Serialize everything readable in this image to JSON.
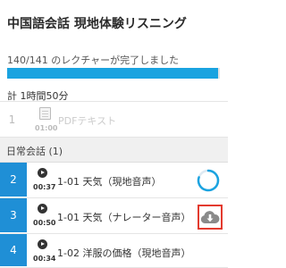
{
  "course": {
    "title": "中国語会話 現地体験リスニング",
    "progress_text": "140/141 のレクチャーが完了しました",
    "progress_fraction": 0.993,
    "total_time": "計 1時間50分"
  },
  "pdf_item": {
    "number": "1",
    "duration": "01:00",
    "label": "PDFテキスト",
    "icon": "document-icon"
  },
  "section": {
    "label": "日常会話 (1)"
  },
  "lessons": [
    {
      "number": "2",
      "duration": "00:37",
      "title": "1-01 天気（現地音声）",
      "status_icon": "progress-ring-icon"
    },
    {
      "number": "3",
      "duration": "00:50",
      "title": "1-01 天気（ナレーター音声）",
      "status_icon": "cloud-download-icon"
    },
    {
      "number": "4",
      "duration": "00:34",
      "title": "1-02 洋服の価格（現地音声）"
    }
  ],
  "colors": {
    "accent": "#1f8fd6",
    "progress": "#1aa3e0",
    "highlight_box": "#e33a2e",
    "icon_gray": "#8a8a8a"
  }
}
